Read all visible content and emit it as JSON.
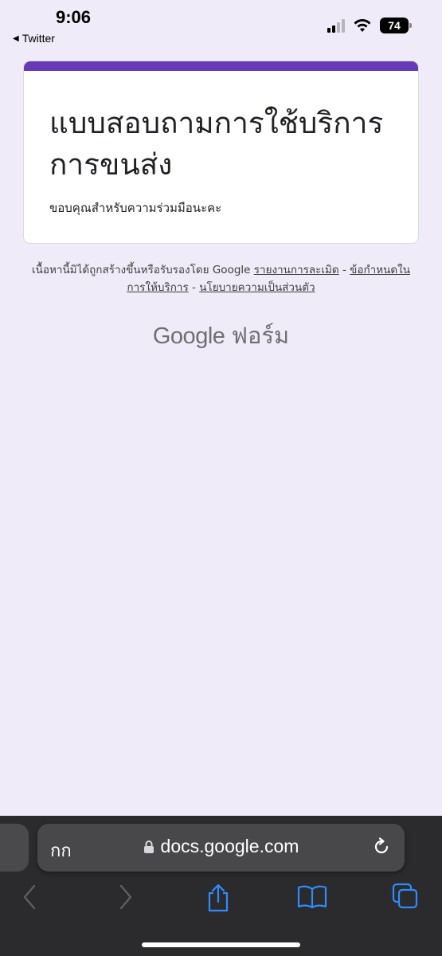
{
  "status_bar": {
    "time": "9:06",
    "back_app": "Twitter",
    "battery": "74"
  },
  "form": {
    "title": "แบบสอบถามการใช้บริการการขนส่ง",
    "description": "ขอบคุณสำหรับความร่วมมือนะคะ",
    "accent_color": "#673ab7"
  },
  "disclaimer": {
    "text": "เนื้อหานี้มิได้ถูกสร้างขึ้นหรือรับรองโดย Google",
    "report_link": "รายงานการละเมิด",
    "terms_link": "ข้อกำหนดในการให้บริการ",
    "privacy_link": "นโยบายความเป็นส่วนตัว",
    "separator": "-"
  },
  "brand": {
    "google": "Google",
    "product": "ฟอร์ม"
  },
  "browser": {
    "aa_label": "กก",
    "url": "docs.google.com",
    "icons": [
      "back-icon",
      "forward-icon",
      "share-icon",
      "bookmarks-icon",
      "tabs-icon",
      "lock-icon",
      "reload-icon"
    ]
  }
}
